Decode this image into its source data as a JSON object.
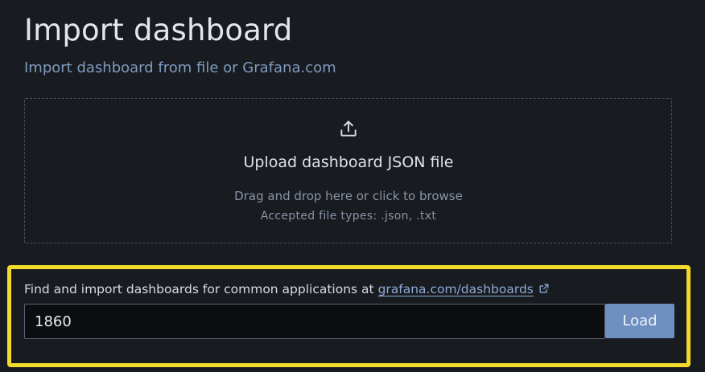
{
  "header": {
    "title": "Import dashboard",
    "subtitle": "Import dashboard from file or Grafana.com"
  },
  "upload": {
    "icon": "upload-icon",
    "title": "Upload dashboard JSON file",
    "hint": "Drag and drop here or click to browse",
    "accepted": "Accepted file types: .json, .txt"
  },
  "grafana_import": {
    "prompt": "Find and import dashboards for common applications at ",
    "link_text": "grafana.com/dashboards",
    "link_icon": "external-link-icon",
    "input_value": "1860",
    "load_label": "Load",
    "highlight_color": "#f2db2c"
  },
  "colors": {
    "background": "#181b1f",
    "accent": "#6e8fc0",
    "link": "#8eaad6"
  }
}
